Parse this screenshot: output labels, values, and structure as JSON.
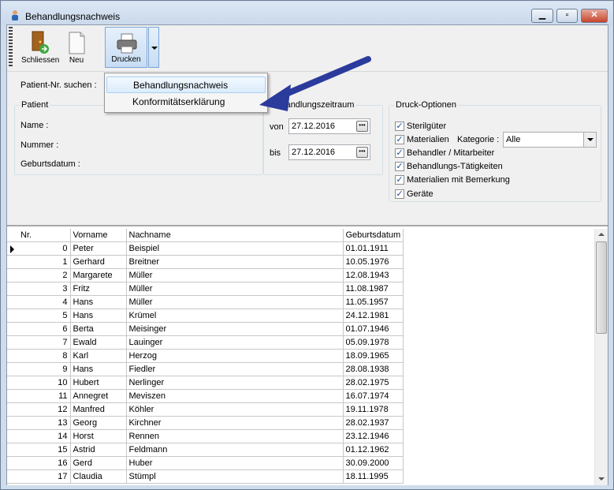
{
  "window": {
    "title": "Behandlungsnachweis"
  },
  "toolbar": {
    "close_label": "Schliessen",
    "new_label": "Neu",
    "print_label": "Drucken"
  },
  "search": {
    "label": "Patient-Nr. suchen :"
  },
  "print_menu": {
    "items": [
      "Behandlungsnachweis",
      "Konformitätserklärung"
    ]
  },
  "patient": {
    "title": "Patient",
    "name_label": "Name :",
    "number_label": "Nummer :",
    "birth_label": "Geburtsdatum :"
  },
  "period": {
    "title": "Behandlungszeitraum",
    "from_label": "von",
    "from_value": "27.12.2016",
    "to_label": "bis",
    "to_value": "27.12.2016",
    "btn": "•••"
  },
  "options": {
    "title": "Druck-Optionen",
    "items": [
      "Sterilgüter",
      "Materialien",
      "Behandler / Mitarbeiter",
      "Behandlungs-Tätigkeiten",
      "Materialien mit Bemerkung",
      "Geräte"
    ],
    "category_label": "Kategorie :",
    "category_value": "Alle",
    "check_mark": "✓"
  },
  "grid": {
    "columns": [
      "Nr.",
      "Vorname",
      "Nachname",
      "Geburtsdatum"
    ],
    "rows": [
      [
        "0",
        "Peter",
        "Beispiel",
        "01.01.1911"
      ],
      [
        "1",
        "Gerhard",
        "Breitner",
        "10.05.1976"
      ],
      [
        "2",
        "Margarete",
        "Müller",
        "12.08.1943"
      ],
      [
        "3",
        "Fritz",
        "Müller",
        "11.08.1987"
      ],
      [
        "4",
        "Hans",
        "Müller",
        "11.05.1957"
      ],
      [
        "5",
        "Hans",
        "Krümel",
        "24.12.1981"
      ],
      [
        "6",
        "Berta",
        "Meisinger",
        "01.07.1946"
      ],
      [
        "7",
        "Ewald",
        "Lauinger",
        "05.09.1978"
      ],
      [
        "8",
        "Karl",
        "Herzog",
        "18.09.1965"
      ],
      [
        "9",
        "Hans",
        "Fiedler",
        "28.08.1938"
      ],
      [
        "10",
        "Hubert",
        "Nerlinger",
        "28.02.1975"
      ],
      [
        "11",
        "Annegret",
        "Meviszen",
        "16.07.1974"
      ],
      [
        "12",
        "Manfred",
        "Köhler",
        "19.11.1978"
      ],
      [
        "13",
        "Georg",
        "Kirchner",
        "28.02.1937"
      ],
      [
        "14",
        "Horst",
        "Rennen",
        "23.12.1946"
      ],
      [
        "15",
        "Astrid",
        "Feldmann",
        "01.12.1962"
      ],
      [
        "16",
        "Gerd",
        "Huber",
        "30.09.2000"
      ],
      [
        "17",
        "Claudia",
        "Stümpl",
        "18.11.1995"
      ]
    ]
  },
  "colors": {
    "arrow": "#2b3b9c",
    "titlebar": "#cfdcec"
  }
}
